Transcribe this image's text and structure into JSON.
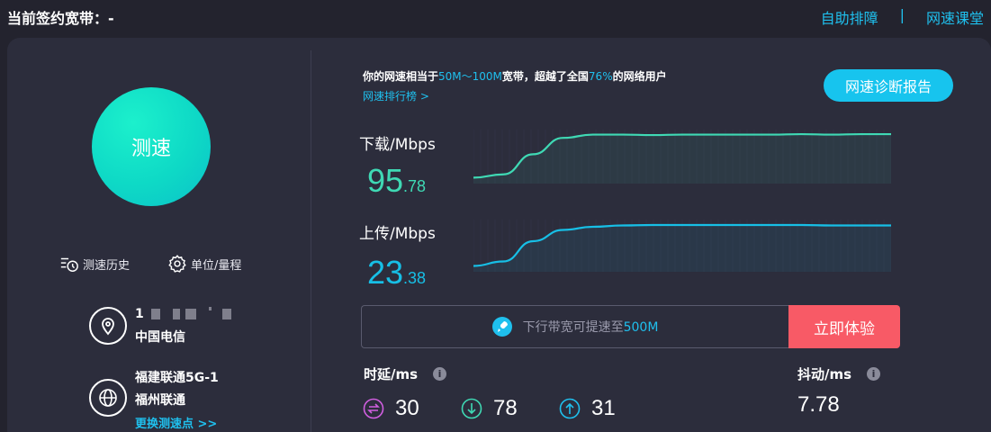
{
  "header": {
    "contract_label": "当前签约宽带：-",
    "links": [
      "自助排障",
      "网速课堂"
    ],
    "separator": "|"
  },
  "left": {
    "speed_button": "测速",
    "tools": [
      {
        "label": "测速历史",
        "icon": "history-icon"
      },
      {
        "label": "单位/量程",
        "icon": "gear-icon"
      }
    ],
    "location": {
      "icon": "location-pin-icon",
      "ip_prefix": "1",
      "isp": "中国电信"
    },
    "server": {
      "icon": "globe-icon",
      "name": "福建联通5G-1",
      "city": "福州联通",
      "change_link": "更换测速点 >>"
    }
  },
  "summary": {
    "prefix": "你的网速相当于",
    "band": "50M～100M",
    "mid": "宽带，超越了全国",
    "percent": "76%",
    "suffix": "的网络用户",
    "rank_link": "网速排行榜 >"
  },
  "report_button": "网速诊断报告",
  "download": {
    "label": "下载/Mbps",
    "int": "95",
    "dec": ".78",
    "color": "#3fd9b4"
  },
  "upload": {
    "label": "上传/Mbps",
    "int": "23",
    "dec": ".38",
    "color": "#17bfe6"
  },
  "boost": {
    "icon": "rocket-icon",
    "text": "下行带宽可提速至",
    "highlight": "500M",
    "button": "立即体验"
  },
  "latency": {
    "label": "时延/ms",
    "help_icon": "i",
    "values": [
      {
        "value": "30",
        "icon": "bidirectional-icon",
        "color": "#d15ee0"
      },
      {
        "value": "78",
        "icon": "arrow-down-icon",
        "color": "#3fd9b4"
      },
      {
        "value": "31",
        "icon": "arrow-up-icon",
        "color": "#1fc0ee"
      }
    ]
  },
  "jitter": {
    "label": "抖动/ms",
    "help_icon": "i",
    "value": "7.78"
  },
  "chart_data": [
    {
      "type": "area",
      "series": [
        {
          "values": [
            0.05,
            0.12,
            0.55,
            0.9,
            0.97,
            0.97,
            0.96,
            0.97,
            0.97,
            0.97,
            0.97,
            0.98,
            0.97,
            0.98,
            0.98
          ]
        }
      ],
      "color": "#3fd9b4"
    },
    {
      "type": "area",
      "series": [
        {
          "values": [
            0.05,
            0.15,
            0.6,
            0.85,
            0.92,
            0.95,
            0.96,
            0.96,
            0.96,
            0.96,
            0.96,
            0.96,
            0.95,
            0.95,
            0.95
          ]
        }
      ],
      "color": "#17bfe6"
    }
  ]
}
